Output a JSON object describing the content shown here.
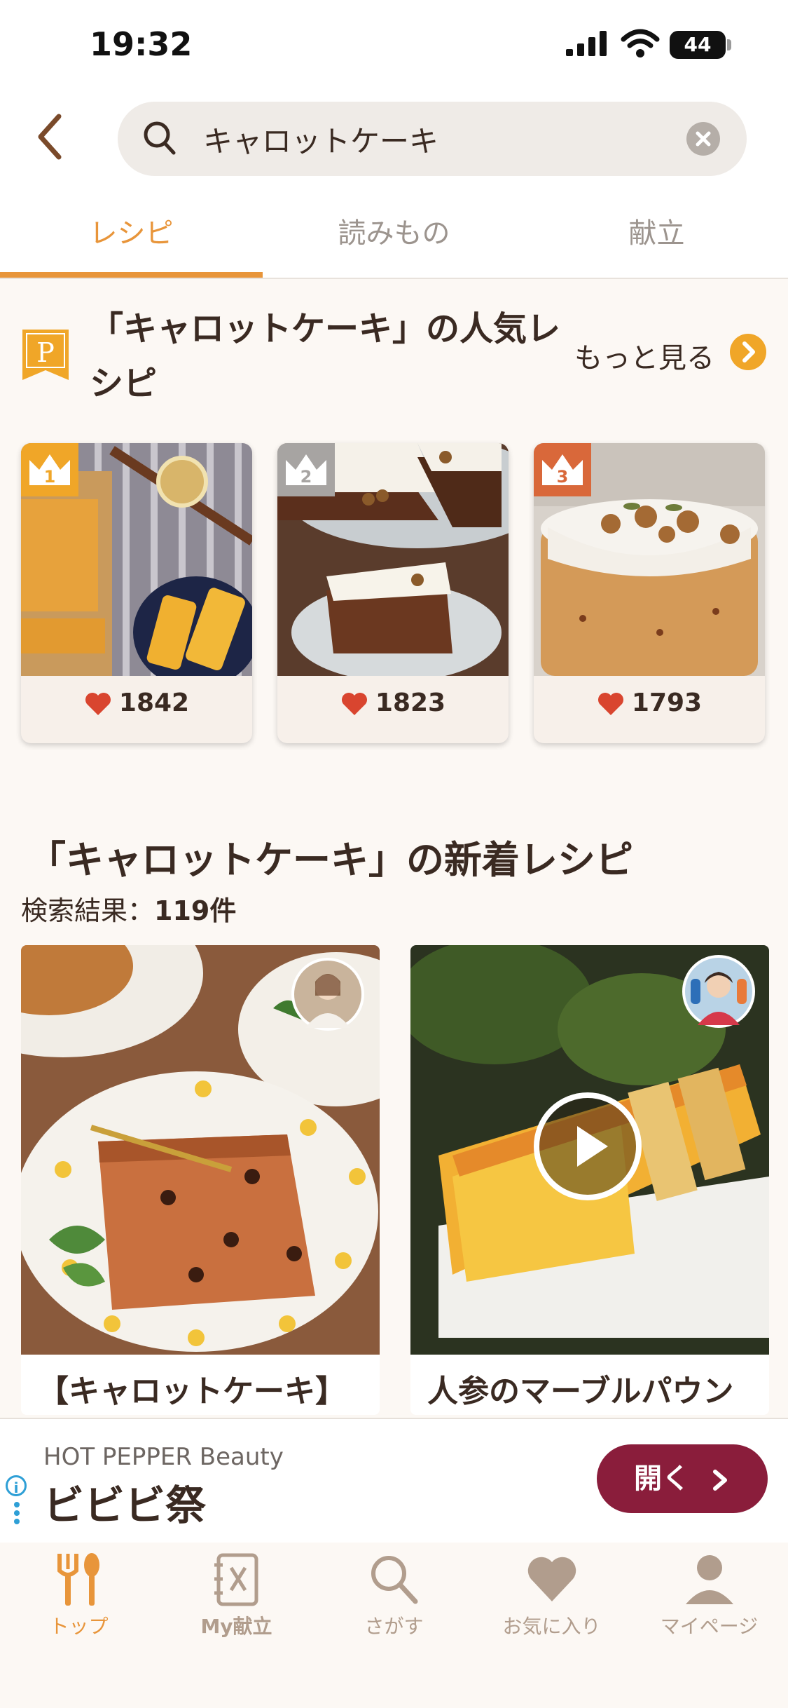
{
  "status_bar": {
    "time": "19:32",
    "battery": "44"
  },
  "search": {
    "query": "キャロットケーキ"
  },
  "tabs": [
    {
      "label": "レシピ",
      "active": true
    },
    {
      "label": "読みもの",
      "active": false
    },
    {
      "label": "献立",
      "active": false
    }
  ],
  "popular": {
    "badge": "P",
    "title": "「キャロットケーキ」の人気レシピ",
    "more_label": "もっと見る",
    "items": [
      {
        "rank": "1",
        "likes": "1842"
      },
      {
        "rank": "2",
        "likes": "1823"
      },
      {
        "rank": "3",
        "likes": "1793"
      }
    ]
  },
  "new_recipes": {
    "title": "「キャロットケーキ」の新着レシピ",
    "result_label": "検索結果：",
    "result_count": "119件",
    "items": [
      {
        "title": "【キャロットケーキ】"
      },
      {
        "title": "人参のマーブルパウン"
      }
    ]
  },
  "ad": {
    "sponsor": "HOT PEPPER Beauty",
    "headline": "ビビビ祭",
    "button_label": "開く",
    "info_icon": "i"
  },
  "nav": [
    {
      "label": "トップ",
      "icon": "fork-spoon-icon",
      "active": true
    },
    {
      "label": "My献立",
      "icon": "notebook-icon",
      "active": false
    },
    {
      "label": "さがす",
      "icon": "search-icon",
      "active": false
    },
    {
      "label": "お気に入り",
      "icon": "heart-icon",
      "active": false
    },
    {
      "label": "マイページ",
      "icon": "person-icon",
      "active": false
    }
  ],
  "colors": {
    "accent": "#e8953a",
    "ad_button": "#8a1d3b",
    "heart": "#d9452f",
    "background": "#fcf8f4"
  }
}
